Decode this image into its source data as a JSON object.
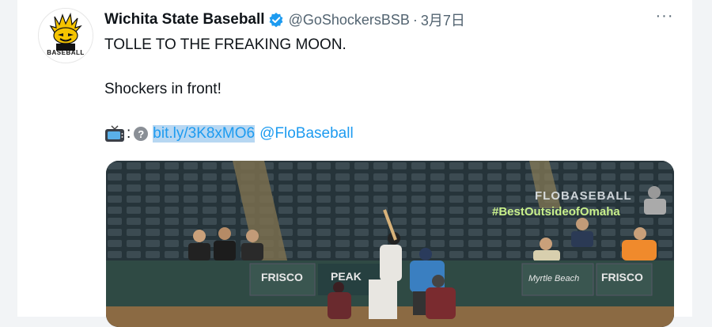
{
  "tweet": {
    "author_name": "Wichita State Baseball",
    "handle": "@GoShockersBSB",
    "separator": "·",
    "date": "3月7日",
    "line1": "TOLLE TO THE FREAKING MOON.",
    "line2": "Shockers in front!",
    "line3_colon": ":",
    "link_text": "bit.ly/3K8xMO6",
    "mention": "@FloBaseball",
    "more_label": "···"
  },
  "avatar": {
    "caption": "BASEBALL"
  },
  "media": {
    "watermark_brand": "FLOBASEBALL",
    "watermark_tag": "#BestOutsideofOmaha",
    "signs": [
      "FRISCO",
      "PEAK",
      "Myrtle Beach",
      "FRISCO"
    ]
  },
  "colors": {
    "accent": "#1d9bf0",
    "verified": "#1d9bf0",
    "text": "#0f1419",
    "muted": "#536471"
  }
}
